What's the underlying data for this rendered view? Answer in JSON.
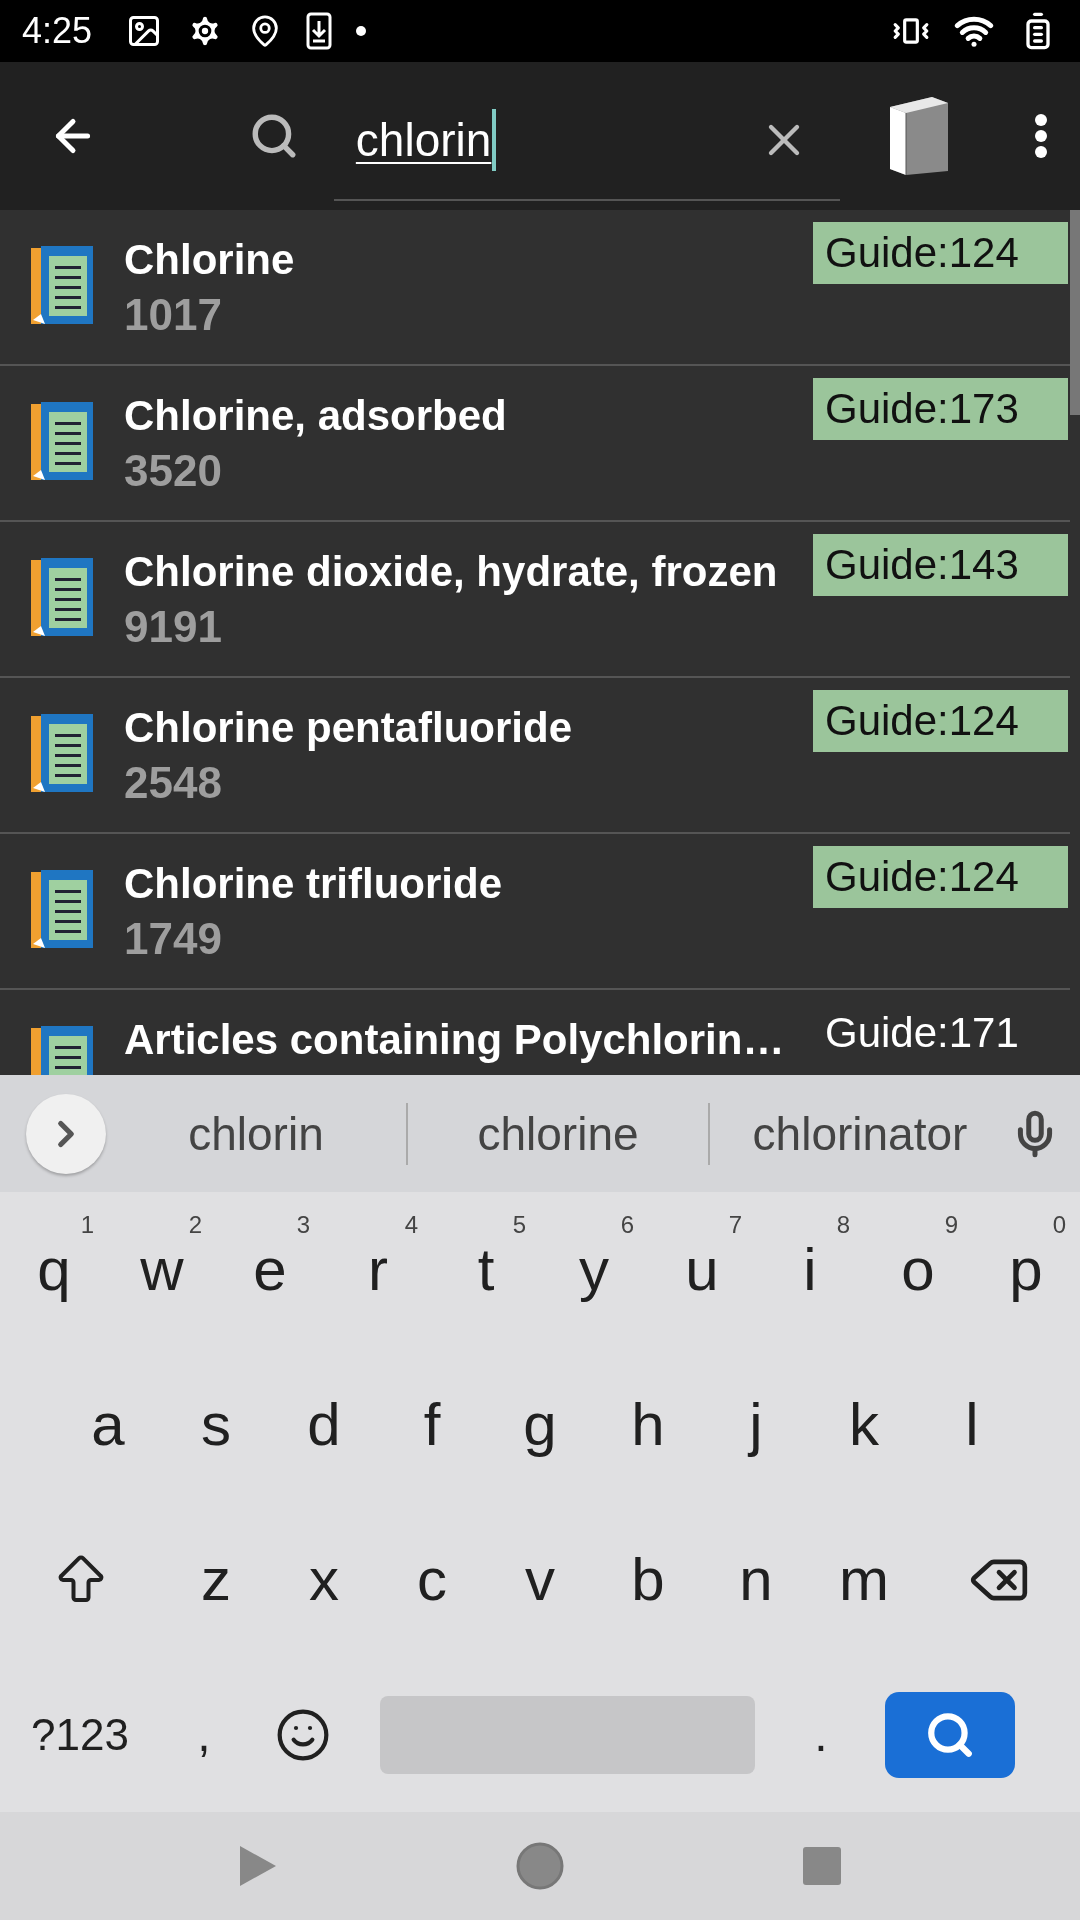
{
  "status_bar": {
    "time": "4:25"
  },
  "search": {
    "value": "chlorin"
  },
  "results": [
    {
      "name": "Chlorine",
      "number": "1017",
      "guide": "Guide:124",
      "highlighted": true
    },
    {
      "name": "Chlorine, adsorbed",
      "number": "3520",
      "guide": "Guide:173",
      "highlighted": true
    },
    {
      "name": "Chlorine dioxide, hydrate, frozen",
      "number": "9191",
      "guide": "Guide:143",
      "highlighted": true
    },
    {
      "name": "Chlorine pentafluoride",
      "number": "2548",
      "guide": "Guide:124",
      "highlighted": true
    },
    {
      "name": "Chlorine trifluoride",
      "number": "1749",
      "guide": "Guide:124",
      "highlighted": true
    },
    {
      "name": "Articles containing Polychlorin…",
      "guide": "Guide:171",
      "highlighted": false
    }
  ],
  "suggestions": [
    "chlorin",
    "chlorine",
    "chlorinator"
  ],
  "keyboard": {
    "rows": [
      [
        {
          "kind": "letter",
          "label": "q",
          "hint": "1"
        },
        {
          "kind": "letter",
          "label": "w",
          "hint": "2"
        },
        {
          "kind": "letter",
          "label": "e",
          "hint": "3"
        },
        {
          "kind": "letter",
          "label": "r",
          "hint": "4"
        },
        {
          "kind": "letter",
          "label": "t",
          "hint": "5"
        },
        {
          "kind": "letter",
          "label": "y",
          "hint": "6"
        },
        {
          "kind": "letter",
          "label": "u",
          "hint": "7"
        },
        {
          "kind": "letter",
          "label": "i",
          "hint": "8"
        },
        {
          "kind": "letter",
          "label": "o",
          "hint": "9"
        },
        {
          "kind": "letter",
          "label": "p",
          "hint": "0"
        }
      ],
      [
        {
          "kind": "letter",
          "label": "a"
        },
        {
          "kind": "letter",
          "label": "s"
        },
        {
          "kind": "letter",
          "label": "d"
        },
        {
          "kind": "letter",
          "label": "f"
        },
        {
          "kind": "letter",
          "label": "g"
        },
        {
          "kind": "letter",
          "label": "h"
        },
        {
          "kind": "letter",
          "label": "j"
        },
        {
          "kind": "letter",
          "label": "k"
        },
        {
          "kind": "letter",
          "label": "l"
        }
      ],
      [
        {
          "kind": "shift"
        },
        {
          "kind": "letter",
          "label": "z"
        },
        {
          "kind": "letter",
          "label": "x"
        },
        {
          "kind": "letter",
          "label": "c"
        },
        {
          "kind": "letter",
          "label": "v"
        },
        {
          "kind": "letter",
          "label": "b"
        },
        {
          "kind": "letter",
          "label": "n"
        },
        {
          "kind": "letter",
          "label": "m"
        },
        {
          "kind": "backspace"
        }
      ],
      [
        {
          "kind": "symbols",
          "label": "?123"
        },
        {
          "kind": "punct",
          "label": ","
        },
        {
          "kind": "emoji"
        },
        {
          "kind": "space"
        },
        {
          "kind": "punct",
          "label": "."
        },
        {
          "kind": "search"
        }
      ]
    ]
  }
}
